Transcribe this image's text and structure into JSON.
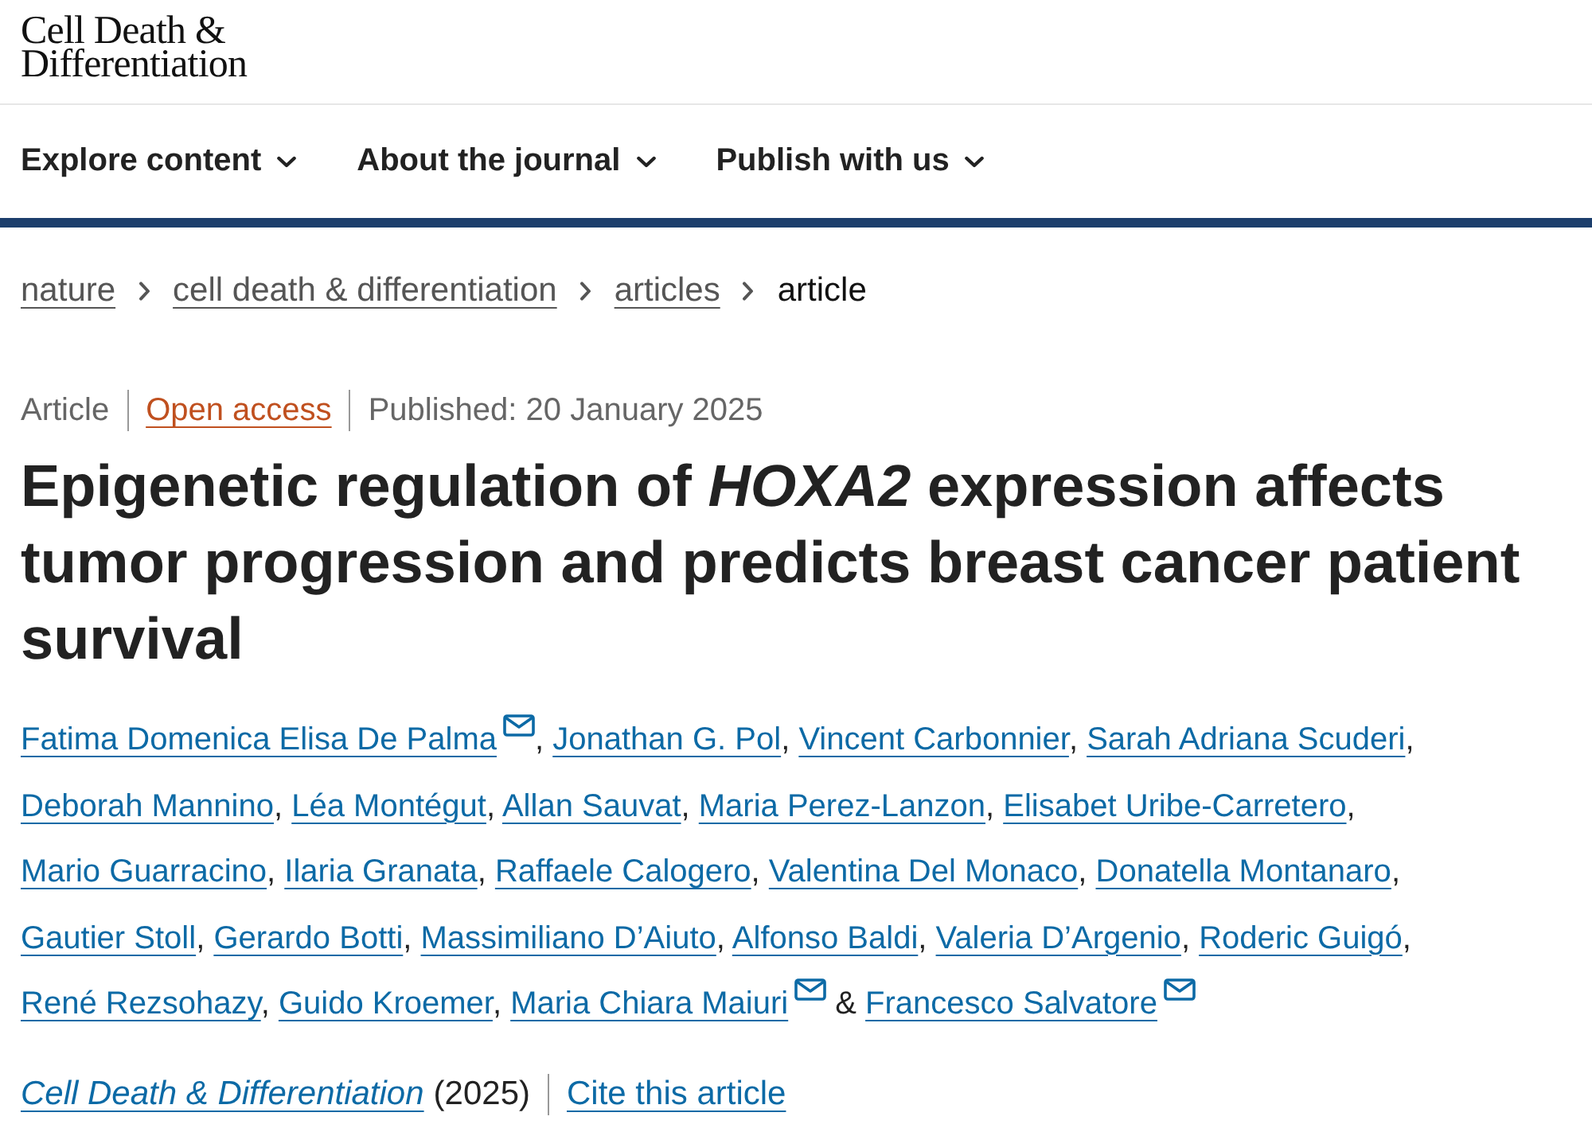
{
  "logo": {
    "lines": [
      "Cell Death &",
      "Differentiation"
    ]
  },
  "nav": [
    {
      "label": "Explore content"
    },
    {
      "label": "About the journal"
    },
    {
      "label": "Publish with us"
    }
  ],
  "breadcrumb": [
    {
      "label": "nature",
      "kind": "link"
    },
    {
      "label": "cell death & differentiation",
      "kind": "link"
    },
    {
      "label": "articles",
      "kind": "link"
    },
    {
      "label": "article",
      "kind": "current"
    }
  ],
  "article": {
    "meta": [
      {
        "text": "Article",
        "kind": "type"
      },
      {
        "text": "Open access",
        "kind": "access"
      },
      {
        "text": "Published: 20 January 2025",
        "kind": "date"
      }
    ],
    "title": "Epigenetic regulation of *HOXA2* expression affects tumor progression and predicts breast cancer patient survival",
    "authors": [
      {
        "name": "Fatima Domenica Elisa De Palma",
        "email": true
      },
      {
        "name": "Jonathan G. Pol",
        "email": false
      },
      {
        "name": "Vincent Carbonnier",
        "email": false
      },
      {
        "name": "Sarah Adriana Scuderi",
        "email": false
      },
      {
        "name": "Deborah Mannino",
        "email": false
      },
      {
        "name": "Léa Montégut",
        "email": false
      },
      {
        "name": "Allan Sauvat",
        "email": false
      },
      {
        "name": "Maria Perez-Lanzon",
        "email": false
      },
      {
        "name": "Elisabet Uribe-Carretero",
        "email": false
      },
      {
        "name": "Mario Guarracino",
        "email": false
      },
      {
        "name": "Ilaria Granata",
        "email": false
      },
      {
        "name": "Raffaele Calogero",
        "email": false
      },
      {
        "name": "Valentina Del Monaco",
        "email": false
      },
      {
        "name": "Donatella Montanaro",
        "email": false
      },
      {
        "name": "Gautier Stoll",
        "email": false
      },
      {
        "name": "Gerardo Botti",
        "email": false
      },
      {
        "name": "Massimiliano D’Aiuto",
        "email": false
      },
      {
        "name": "Alfonso Baldi",
        "email": false
      },
      {
        "name": "Valeria D’Argenio",
        "email": false
      },
      {
        "name": "Roderic Guigó",
        "email": false
      },
      {
        "name": "René Rezsohazy",
        "email": false
      },
      {
        "name": "Guido Kroemer",
        "email": false
      },
      {
        "name": "Maria Chiara Maiuri",
        "email": true
      },
      {
        "name": "Francesco Salvatore",
        "email": true
      }
    ],
    "author_separator": ",",
    "last_separator": "&",
    "citation": {
      "journal": "Cell Death & Differentiation",
      "year": "(2025)",
      "cite_link": "Cite this article"
    }
  }
}
